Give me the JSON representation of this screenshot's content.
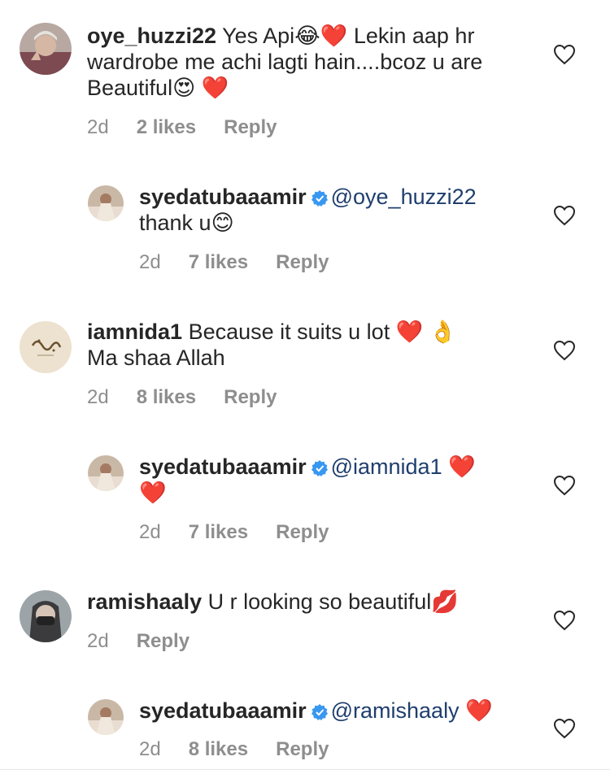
{
  "comments": [
    {
      "username": "oye_huzzi22",
      "text_lines": [
        "Yes Api😂❤️ Lekin aap hr",
        "wardrobe me achi lagti hain....bcoz u are",
        "Beautiful😍 ❤️"
      ],
      "time": "2d",
      "likes": "2 likes",
      "reply": "Reply"
    },
    {
      "username": "syedatubaaamir",
      "mention": "@oye_huzzi22",
      "text": "thank u😊",
      "time": "2d",
      "likes": "7 likes",
      "reply": "Reply"
    },
    {
      "username": "iamnida1",
      "text": "Because it suits u lot ❤️ 👌",
      "text2": "Ma shaa Allah",
      "time": "2d",
      "likes": "8 likes",
      "reply": "Reply"
    },
    {
      "username": "syedatubaaamir",
      "mention": "@iamnida1",
      "text": "❤️",
      "trail": "❤️",
      "time": "2d",
      "likes": "7 likes",
      "reply": "Reply"
    },
    {
      "username": "ramishaaly",
      "text": "U r looking so beautiful💋",
      "time": "2d",
      "reply": "Reply"
    },
    {
      "username": "syedatubaaamir",
      "mention": "@ramishaaly",
      "text": "❤️",
      "time": "2d",
      "likes": "8 likes",
      "reply": "Reply"
    }
  ],
  "colors": {
    "accent_verified": "#3897f0",
    "mention": "#1f3e6e",
    "meta": "#8e8e8e"
  },
  "icons": {
    "like": "heart-outline-icon",
    "verified": "verified-badge-icon"
  }
}
